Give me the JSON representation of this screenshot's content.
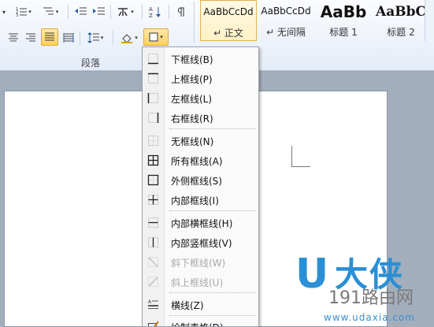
{
  "paragraph_group": {
    "label": "段落"
  },
  "styles": [
    {
      "preview": "AaBbCcDd",
      "name": "↵ 正文",
      "selected": true
    },
    {
      "preview": "AaBbCcDd",
      "name": "↵ 无间隔",
      "selected": false
    },
    {
      "preview": "AaBb",
      "name": "标题 1",
      "selected": false
    },
    {
      "preview": "AaBbC",
      "name": "标题 2",
      "selected": false
    }
  ],
  "border_menu": {
    "items": [
      {
        "label": "下框线(B)",
        "icon": "bottom-border-icon",
        "enabled": true
      },
      {
        "label": "上框线(P)",
        "icon": "top-border-icon",
        "enabled": true
      },
      {
        "label": "左框线(L)",
        "icon": "left-border-icon",
        "enabled": true
      },
      {
        "label": "右框线(R)",
        "icon": "right-border-icon",
        "enabled": true
      },
      {
        "label": "无框线(N)",
        "icon": "no-border-icon",
        "enabled": true
      },
      {
        "label": "所有框线(A)",
        "icon": "all-borders-icon",
        "enabled": true
      },
      {
        "label": "外侧框线(S)",
        "icon": "outside-borders-icon",
        "enabled": true
      },
      {
        "label": "内部框线(I)",
        "icon": "inside-borders-icon",
        "enabled": true
      },
      {
        "label": "内部横框线(H)",
        "icon": "inside-horizontal-border-icon",
        "enabled": true
      },
      {
        "label": "内部竖框线(V)",
        "icon": "inside-vertical-border-icon",
        "enabled": true
      },
      {
        "label": "斜下框线(W)",
        "icon": "diagonal-down-border-icon",
        "enabled": false
      },
      {
        "label": "斜上框线(U)",
        "icon": "diagonal-up-border-icon",
        "enabled": false
      },
      {
        "label": "横线(Z)",
        "icon": "horizontal-line-icon",
        "enabled": true
      },
      {
        "label": "绘制表格(D)",
        "icon": "draw-table-icon",
        "enabled": true
      }
    ]
  },
  "watermark": {
    "brand": "U大侠",
    "site": "191路由网",
    "url": "www.udaxia.com"
  },
  "colors": {
    "active_button": "#ffd35a",
    "disabled_text": "#a8a8a8",
    "watermark_blue": "#2a8fd4"
  }
}
